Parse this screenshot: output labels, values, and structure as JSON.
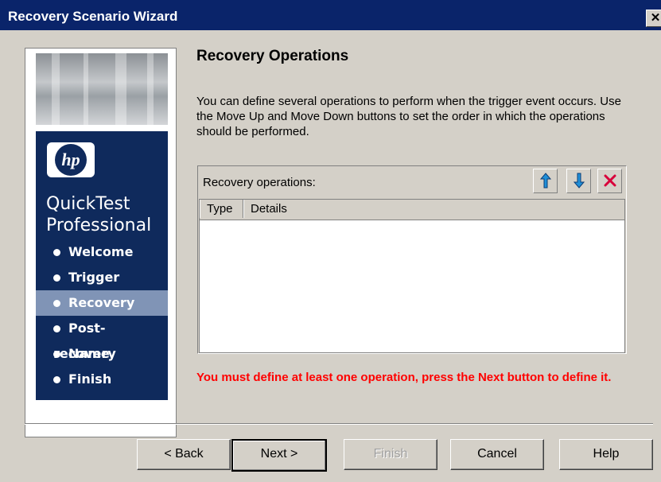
{
  "window": {
    "title": "Recovery Scenario Wizard",
    "close_glyph": "✕"
  },
  "sidebar": {
    "logo_text": "hp",
    "product_line1": "QuickTest",
    "product_line2": "Professional",
    "steps": [
      {
        "label": "Welcome",
        "active": false
      },
      {
        "label": "Trigger",
        "active": false
      },
      {
        "label": "Recovery",
        "active": true
      },
      {
        "label": "Post-recovery",
        "active": false
      },
      {
        "label": "Name",
        "active": false
      },
      {
        "label": "Finish",
        "active": false
      }
    ]
  },
  "page": {
    "heading": "Recovery Operations",
    "description": "You can define several operations to perform when the trigger event occurs. Use the Move Up and Move Down buttons to set the order in which the operations should be performed.",
    "list_label": "Recovery operations:",
    "columns": [
      "Type",
      "Details"
    ],
    "rows": [],
    "error": "You must define at least one operation, press the Next button to define it."
  },
  "toolbar": {
    "move_up_icon": "arrow-up-icon",
    "move_down_icon": "arrow-down-icon",
    "delete_icon": "delete-x-icon"
  },
  "buttons": {
    "back": "< Back",
    "next": "Next >",
    "finish": "Finish",
    "cancel": "Cancel",
    "help": "Help"
  },
  "colors": {
    "title_bar": "#0a246a",
    "sidebar_blue": "#0f2a5c",
    "active_step": "#8094b6",
    "error_text": "#ff0000",
    "arrow": "#1f8fd8",
    "delete": "#d8003a"
  }
}
